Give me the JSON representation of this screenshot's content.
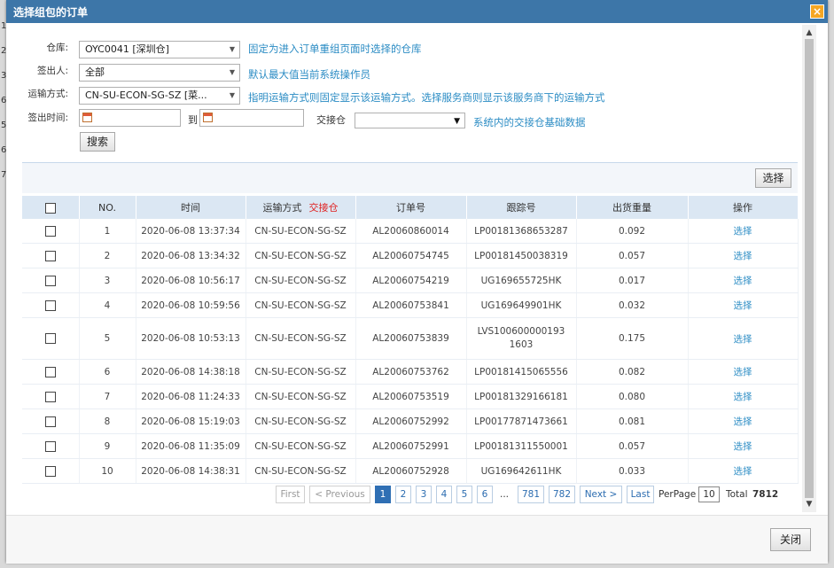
{
  "background": {
    "left_chars": [
      "1",
      "2",
      "3",
      "6",
      "5",
      "6",
      "7"
    ]
  },
  "dialog": {
    "title": "选择组包的订单",
    "close_icon": "×"
  },
  "filters": {
    "warehouse": {
      "label": "仓库:",
      "value": "OYC0041 [深圳仓]",
      "hint": "固定为进入订单重组页面时选择的仓库"
    },
    "signer": {
      "label": "签出人:",
      "value": "全部",
      "hint": "默认最大值当前系统操作员"
    },
    "shipping": {
      "label": "运输方式:",
      "value": "CN-SU-ECON-SG-SZ [菜...",
      "hint": "指明运输方式则固定显示该运输方式。选择服务商则显示该服务商下的运输方式"
    },
    "sign_time": {
      "label": "签出时间:",
      "to": "到"
    },
    "handover": {
      "label": "交接仓",
      "value": "",
      "hint": "系统内的交接仓基础数据"
    },
    "search_button": "搜索"
  },
  "toolbar": {
    "select_button": "选择"
  },
  "table": {
    "headers": {
      "no": "NO.",
      "time": "时间",
      "shipping": "运输方式",
      "handover": "交接仓",
      "order": "订单号",
      "tracking": "跟踪号",
      "weight": "出货重量",
      "action": "操作"
    },
    "rows": [
      {
        "no": "1",
        "time": "2020-06-08 13:37:34",
        "shipping": "CN-SU-ECON-SG-SZ",
        "order": "AL20060860014",
        "tracking": "LP00181368653287",
        "weight": "0.092",
        "action": "选择"
      },
      {
        "no": "2",
        "time": "2020-06-08 13:34:32",
        "shipping": "CN-SU-ECON-SG-SZ",
        "order": "AL20060754745",
        "tracking": "LP00181450038319",
        "weight": "0.057",
        "action": "选择"
      },
      {
        "no": "3",
        "time": "2020-06-08 10:56:17",
        "shipping": "CN-SU-ECON-SG-SZ",
        "order": "AL20060754219",
        "tracking": "UG169655725HK",
        "weight": "0.017",
        "action": "选择"
      },
      {
        "no": "4",
        "time": "2020-06-08 10:59:56",
        "shipping": "CN-SU-ECON-SG-SZ",
        "order": "AL20060753841",
        "tracking": "UG169649901HK",
        "weight": "0.032",
        "action": "选择"
      },
      {
        "no": "5",
        "time": "2020-06-08 10:53:13",
        "shipping": "CN-SU-ECON-SG-SZ",
        "order": "AL20060753839",
        "tracking": "LVS1006000001931603",
        "weight": "0.175",
        "action": "选择"
      },
      {
        "no": "6",
        "time": "2020-06-08 14:38:18",
        "shipping": "CN-SU-ECON-SG-SZ",
        "order": "AL20060753762",
        "tracking": "LP00181415065556",
        "weight": "0.082",
        "action": "选择"
      },
      {
        "no": "7",
        "time": "2020-06-08 11:24:33",
        "shipping": "CN-SU-ECON-SG-SZ",
        "order": "AL20060753519",
        "tracking": "LP00181329166181",
        "weight": "0.080",
        "action": "选择"
      },
      {
        "no": "8",
        "time": "2020-06-08 15:19:03",
        "shipping": "CN-SU-ECON-SG-SZ",
        "order": "AL20060752992",
        "tracking": "LP00177871473661",
        "weight": "0.081",
        "action": "选择"
      },
      {
        "no": "9",
        "time": "2020-06-08 11:35:09",
        "shipping": "CN-SU-ECON-SG-SZ",
        "order": "AL20060752991",
        "tracking": "LP00181311550001",
        "weight": "0.057",
        "action": "选择"
      },
      {
        "no": "10",
        "time": "2020-06-08 14:38:31",
        "shipping": "CN-SU-ECON-SG-SZ",
        "order": "AL20060752928",
        "tracking": "UG169642611HK",
        "weight": "0.033",
        "action": "选择"
      }
    ]
  },
  "pager": {
    "first": "First",
    "previous": "< Previous",
    "pages": [
      "1",
      "2",
      "3",
      "4",
      "5",
      "6"
    ],
    "ellipsis": "...",
    "last_pages": [
      "781",
      "782"
    ],
    "next": "Next >",
    "last": "Last",
    "per_page_label": "PerPage",
    "per_page": "10",
    "total_label": "Total",
    "total": "7812",
    "current_page": 1
  },
  "footer": {
    "close_button": "关闭"
  },
  "colors": {
    "titlebar": "#3d76a8",
    "link": "#2b8cc4",
    "header_bg": "#dbe7f3",
    "active_page": "#2f6fb4",
    "close_icon": "#f5a623"
  }
}
